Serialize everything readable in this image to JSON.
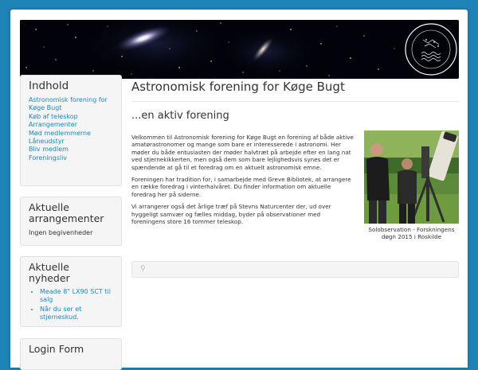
{
  "banner": {
    "seal_text_top": "ASTRONOMISK FORENING",
    "seal_text_bottom": "KØGE BUGT"
  },
  "sidebar": {
    "contents": {
      "title": "Indhold",
      "items": [
        {
          "label": "Astronomisk forening for Køge Bugt"
        },
        {
          "label": "Køb af teleskop"
        },
        {
          "label": "Arrangementer"
        },
        {
          "label": "Mød medlemmerne"
        },
        {
          "label": "Låneudstyr"
        },
        {
          "label": "Bliv medlem"
        },
        {
          "label": "Foreningsliv"
        }
      ]
    },
    "events": {
      "title": "Aktuelle arrangementer",
      "text": "Ingen begivenheder"
    },
    "news": {
      "title": "Aktuelle nyheder",
      "items": [
        {
          "label": "Meade 8\" LX90 SCT til salg"
        },
        {
          "label": "Når du ser et stjerneskud."
        }
      ]
    },
    "login": {
      "title": "Login Form"
    }
  },
  "main": {
    "title": "Astronomisk forening for Køge Bugt",
    "subtitle": "...en aktiv forening",
    "paragraphs": [
      "Velkommen til Astronomisk forening for Køge Bugt en forening af både aktive amatørastronomer og mange som bare er interesserede i astronomi. Her møder du både entusiasten der møder halvtræt på arbejde efter en lang nat ved stjernekikkerten, men også dem som bare lejlighedsvis synes det er spændende at gå til et foredrag om en aktuelt astronomisk emne.",
      "Foreningen har tradition for, i samarbejde med Greve Bibliotek, at arrangere en række foredrag i vinterhalvåret. Du finder information om aktuelle foredrag her på siderne.",
      "Vi arrangerer også det årlige træf på Stevns Naturcenter der, ud over hyggeligt samvær og fælles middag, byder på observationer med foreningens store 16 tommer teleskop."
    ],
    "figure": {
      "caption": "Solobservation - Forskningens døgn 2015 i Roskilde"
    }
  },
  "colors": {
    "page_background": "#1e84b7",
    "link": "#1c86b9",
    "well": "#f5f5f5"
  }
}
